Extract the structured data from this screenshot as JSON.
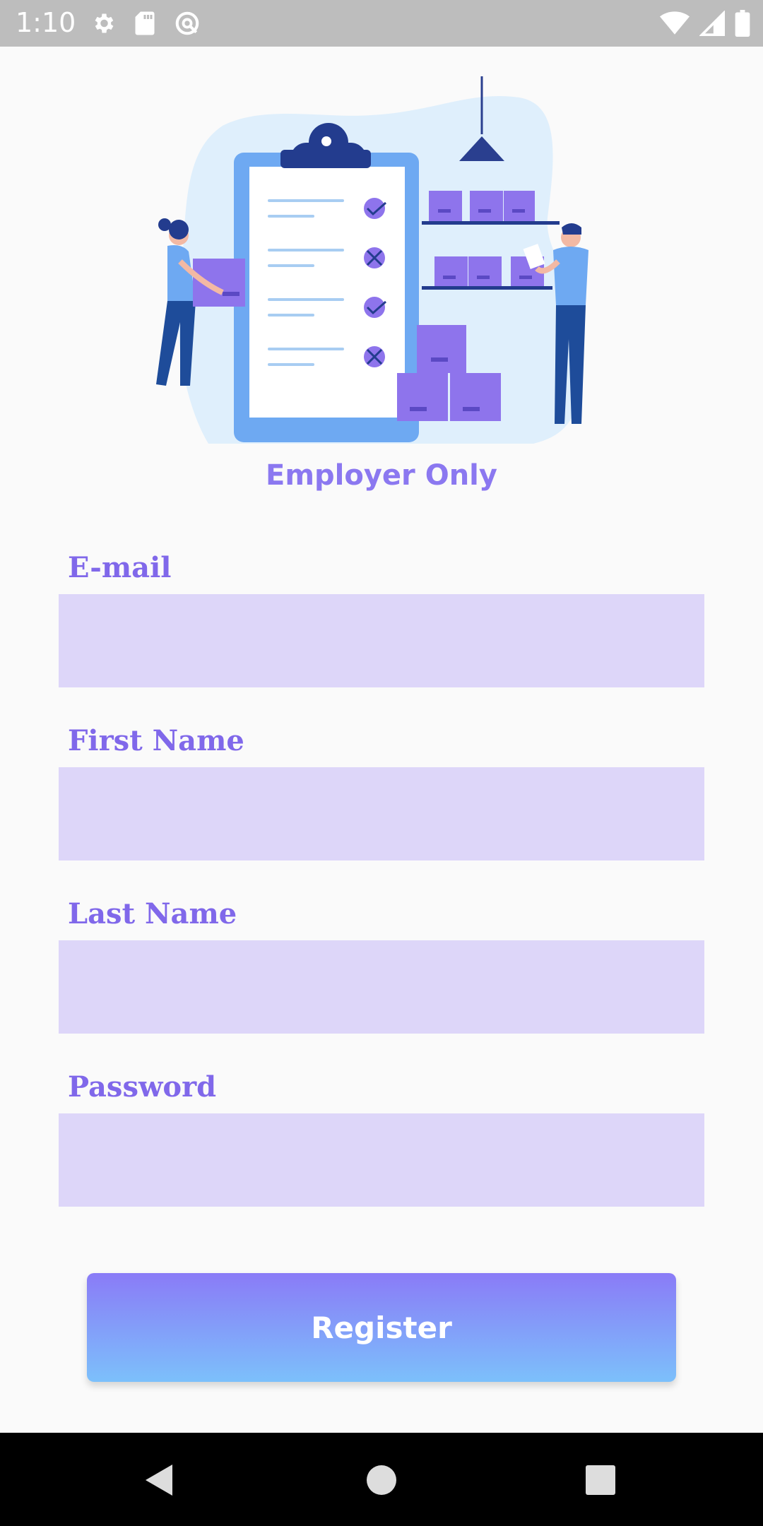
{
  "status_bar": {
    "time": "1:10",
    "left_icons": [
      "settings-icon",
      "sd-card-icon",
      "data-saver-icon"
    ],
    "right_icons": [
      "wifi-icon",
      "cell-signal-icon",
      "battery-icon"
    ]
  },
  "form": {
    "heading": "Employer Only",
    "fields": [
      {
        "label": "E-mail",
        "value": "",
        "placeholder": ""
      },
      {
        "label": "First Name",
        "value": "",
        "placeholder": ""
      },
      {
        "label": "Last Name",
        "value": "",
        "placeholder": ""
      },
      {
        "label": "Password",
        "value": "",
        "placeholder": ""
      }
    ],
    "register_label": "Register"
  },
  "colors": {
    "accent": "#8068ea",
    "input_bg": "#ddd6f9",
    "button_top": "#8a7bf7",
    "button_bottom": "#7cc0fb"
  },
  "nav_bar": {
    "icons": [
      "back-icon",
      "home-icon",
      "recents-icon"
    ]
  }
}
